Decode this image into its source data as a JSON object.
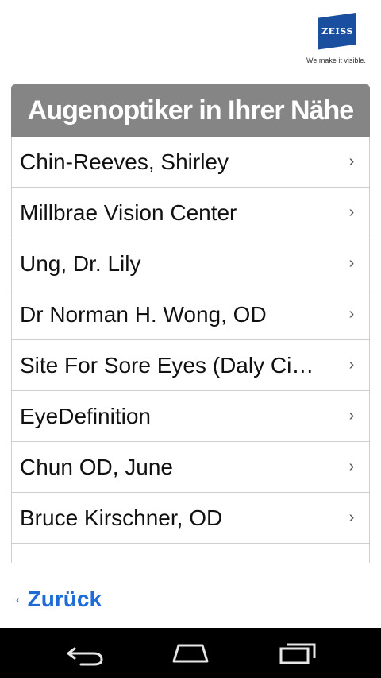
{
  "brand": {
    "logo_text": "ZEISS",
    "tagline": "We make it visible."
  },
  "panel": {
    "title": "Augenoptiker in Ihrer Nähe",
    "items": [
      {
        "label": "Chin-Reeves, Shirley"
      },
      {
        "label": "Millbrae Vision Center"
      },
      {
        "label": "Ung, Dr. Lily"
      },
      {
        "label": "Dr Norman H. Wong, OD"
      },
      {
        "label": "Site For Sore Eyes (Daly Ci…"
      },
      {
        "label": "EyeDefinition"
      },
      {
        "label": "Chun OD, June"
      },
      {
        "label": "Bruce Kirschner, OD"
      },
      {
        "label": ""
      }
    ],
    "chevron": "›"
  },
  "back_link": {
    "chevron": "‹",
    "label": "Zurück"
  },
  "icons": {
    "logo": "zeiss-logo",
    "row_chevron": "chevron-right-icon",
    "nav": [
      "back-icon",
      "home-icon",
      "recent-apps-icon"
    ]
  },
  "colors": {
    "header_bg": "#858585",
    "link": "#1e6bd8",
    "logo_blue": "#1a4fa0",
    "navbar_bg": "#000000"
  }
}
